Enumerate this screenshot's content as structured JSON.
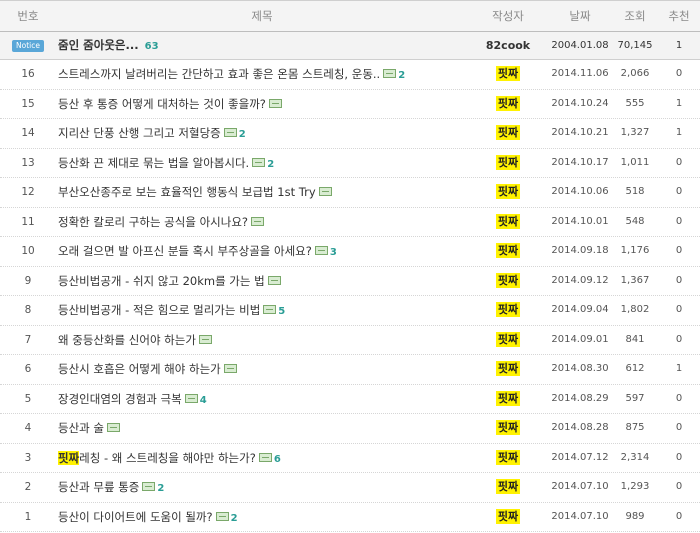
{
  "header": {
    "no": "번호",
    "title": "제목",
    "author": "작성자",
    "date": "날짜",
    "views": "조회",
    "recommend": "추천"
  },
  "notice": {
    "badge": "Notice",
    "title": "줌인 줌아웃은...",
    "comments": "63",
    "author": "82cook",
    "date": "2004.01.08",
    "views": "70,145",
    "recommend": "1"
  },
  "posts": [
    {
      "no": "16",
      "title": "스트레스까지 날려버리는 간단하고 효과 좋은 온몸 스트레칭, 운동..",
      "comments": "2",
      "author": "핏짜",
      "date": "2014.11.06",
      "views": "2,066",
      "recommend": "0"
    },
    {
      "no": "15",
      "title": "등산 후 통증 어떻게 대처하는 것이 좋을까?",
      "comments": "",
      "author": "핏짜",
      "date": "2014.10.24",
      "views": "555",
      "recommend": "1"
    },
    {
      "no": "14",
      "title": "지리산 단풍 산행 그리고 저혈당증",
      "comments": "2",
      "author": "핏짜",
      "date": "2014.10.21",
      "views": "1,327",
      "recommend": "1"
    },
    {
      "no": "13",
      "title": "등산화 끈 제대로 묶는 법을 알아봅시다.",
      "comments": "2",
      "author": "핏짜",
      "date": "2014.10.17",
      "views": "1,011",
      "recommend": "0"
    },
    {
      "no": "12",
      "title": "부산오산종주로 보는 효율적인 행동식 보급법 1st Try",
      "comments": "",
      "author": "핏짜",
      "date": "2014.10.06",
      "views": "518",
      "recommend": "0"
    },
    {
      "no": "11",
      "title": "정확한 칼로리 구하는 공식을 아시나요?",
      "comments": "",
      "author": "핏짜",
      "date": "2014.10.01",
      "views": "548",
      "recommend": "0"
    },
    {
      "no": "10",
      "title": "오래 걸으면 발 아프신 분들 혹시 부주상골을 아세요?",
      "comments": "3",
      "author": "핏짜",
      "date": "2014.09.18",
      "views": "1,176",
      "recommend": "0"
    },
    {
      "no": "9",
      "title": "등산비법공개 - 쉬지 않고 20km를 가는 법",
      "comments": "",
      "author": "핏짜",
      "date": "2014.09.12",
      "views": "1,367",
      "recommend": "0"
    },
    {
      "no": "8",
      "title": "등산비법공개 - 적은 힘으로 멀리가는 비법",
      "comments": "5",
      "author": "핏짜",
      "date": "2014.09.04",
      "views": "1,802",
      "recommend": "0"
    },
    {
      "no": "7",
      "title": "왜 중등산화를 신어야 하는가",
      "comments": "",
      "author": "핏짜",
      "date": "2014.09.01",
      "views": "841",
      "recommend": "0"
    },
    {
      "no": "6",
      "title": "등산시 호흡은 어떻게 해야 하는가",
      "comments": "",
      "author": "핏짜",
      "date": "2014.08.30",
      "views": "612",
      "recommend": "1"
    },
    {
      "no": "5",
      "title": "장경인대염의 경험과 극복",
      "comments": "4",
      "author": "핏짜",
      "date": "2014.08.29",
      "views": "597",
      "recommend": "0"
    },
    {
      "no": "4",
      "title": "등산과 술",
      "comments": "",
      "author": "핏짜",
      "date": "2014.08.28",
      "views": "875",
      "recommend": "0"
    },
    {
      "no": "3",
      "title_highlight": "핏짜",
      "title": "레칭 - 왜 스트레칭을 해야만 하는가?",
      "comments": "6",
      "author": "핏짜",
      "date": "2014.07.12",
      "views": "2,314",
      "recommend": "0"
    },
    {
      "no": "2",
      "title": "등산과 무릎 통증",
      "comments": "2",
      "author": "핏짜",
      "date": "2014.07.10",
      "views": "1,293",
      "recommend": "0"
    },
    {
      "no": "1",
      "title": "등산이 다이어트에 도움이 될까?",
      "comments": "2",
      "author": "핏짜",
      "date": "2014.07.10",
      "views": "989",
      "recommend": "0"
    }
  ]
}
